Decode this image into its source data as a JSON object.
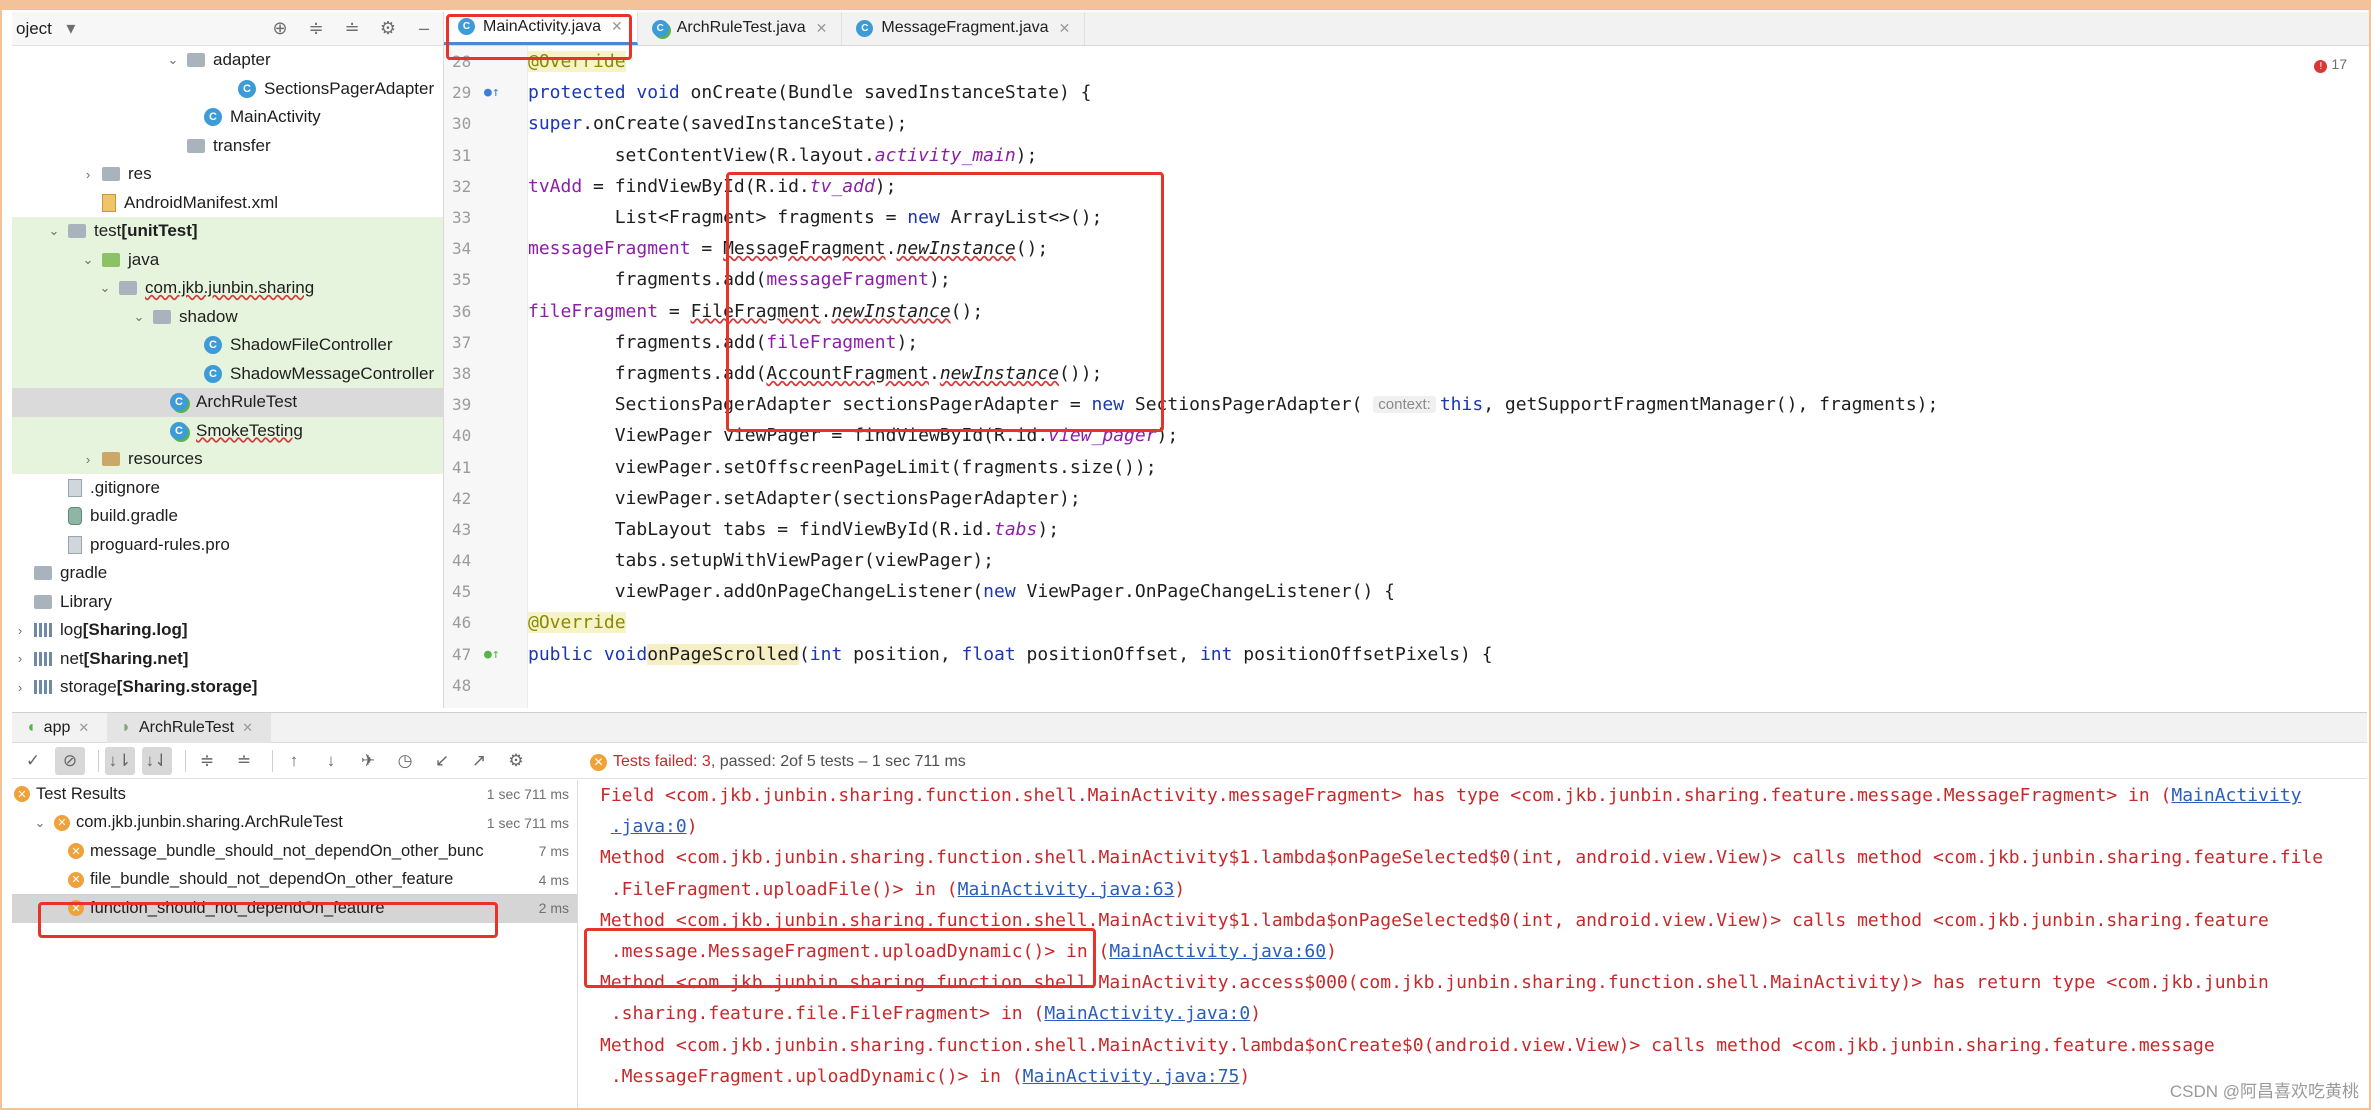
{
  "project_panel": {
    "title": "oject",
    "items": [
      {
        "label": "adapter",
        "type": "folder",
        "indent": 9
      },
      {
        "label": "SectionsPagerAdapter",
        "type": "class",
        "indent": 12
      },
      {
        "label": "MainActivity",
        "type": "class",
        "indent": 10
      },
      {
        "label": "transfer",
        "type": "folder",
        "indent": 9
      },
      {
        "label": "res",
        "type": "folder",
        "indent": 4
      },
      {
        "label": "AndroidManifest.xml",
        "type": "xml",
        "indent": 4
      },
      {
        "label": "test",
        "label_bold": "[unitTest]",
        "type": "folder",
        "indent": 2
      },
      {
        "label": "java",
        "type": "green-folder",
        "indent": 4
      },
      {
        "label": "com.jkb.junbin.sharing",
        "type": "folder",
        "indent": 5
      },
      {
        "label": "shadow",
        "type": "folder",
        "indent": 7
      },
      {
        "label": "ShadowFileController",
        "type": "class",
        "indent": 10
      },
      {
        "label": "ShadowMessageController",
        "type": "class",
        "indent": 10
      },
      {
        "label": "ArchRuleTest",
        "type": "test-class",
        "indent": 8
      },
      {
        "label": "SmokeTesting",
        "type": "test-class",
        "indent": 8
      },
      {
        "label": "resources",
        "type": "folder",
        "indent": 4
      },
      {
        "label": ".gitignore",
        "type": "file",
        "indent": 2
      },
      {
        "label": "build.gradle",
        "type": "gradle",
        "indent": 2
      },
      {
        "label": "proguard-rules.pro",
        "type": "file",
        "indent": 2
      },
      {
        "label": "gradle",
        "type": "folder",
        "indent": 0
      },
      {
        "label": "Library",
        "type": "folder",
        "indent": 0
      },
      {
        "label": "log",
        "label_bold": "[Sharing.log]",
        "type": "lib",
        "indent": 0
      },
      {
        "label": "net",
        "label_bold": "[Sharing.net]",
        "type": "lib",
        "indent": 0
      },
      {
        "label": "storage",
        "label_bold": "[Sharing.storage]",
        "type": "lib",
        "indent": 0
      }
    ]
  },
  "editor": {
    "tabs": [
      {
        "label": "MainActivity.java",
        "active": true
      },
      {
        "label": "ArchRuleTest.java",
        "active": false
      },
      {
        "label": "MessageFragment.java",
        "active": false
      }
    ],
    "error_count": "17",
    "line_numbers": [
      "28",
      "29",
      "30",
      "31",
      "32",
      "33",
      "34",
      "35",
      "36",
      "37",
      "38",
      "39",
      "40",
      "41",
      "42",
      "43",
      "44",
      "45",
      "46",
      "47",
      "48"
    ]
  },
  "run_panel": {
    "tabs": [
      "app",
      "ArchRuleTest"
    ],
    "status": {
      "failed_label": "Tests failed: 3",
      "passed_label": ", passed: 2",
      "total_label": " of 5 tests – 1 sec 711 ms"
    },
    "results": [
      {
        "label": "Test Results",
        "time": "1 sec 711 ms"
      },
      {
        "label": "com.jkb.junbin.sharing.ArchRuleTest",
        "time": "1 sec 711 ms"
      },
      {
        "label": "message_bundle_should_not_dependOn_other_bunc",
        "time": "7 ms"
      },
      {
        "label": "file_bundle_should_not_dependOn_other_feature",
        "time": "4 ms"
      },
      {
        "label": "function_should_not_dependOn_feature",
        "time": "2 ms"
      }
    ],
    "console": [
      {
        "text": "Field <com.jkb.junbin.sharing.function.shell.MainActivity.messageFragment> has type <com.jkb.junbin.sharing.feature.message.MessageFragment> in (",
        "link": "MainActivity",
        "after": ""
      },
      {
        "text": " ",
        "link": ".java:0",
        "after": ")"
      },
      {
        "text": "Method <com.jkb.junbin.sharing.function.shell.MainActivity$1.lambda$onPageSelected$0(int, android.view.View)> calls method <com.jkb.junbin.sharing.feature.file",
        "link": "",
        "after": ""
      },
      {
        "text": " .FileFragment.uploadFile()> in (",
        "link": "MainActivity.java:63",
        "after": ")"
      },
      {
        "text": "Method <com.jkb.junbin.sharing.function.shell.MainActivity$1.lambda$onPageSelected$0(int, android.view.View)> calls method <com.jkb.junbin.sharing.feature",
        "link": "",
        "after": ""
      },
      {
        "text": " .message.MessageFragment.uploadDynamic()> in (",
        "link": "MainActivity.java:60",
        "after": ")"
      },
      {
        "text": "Method <com.jkb.junbin.sharing.function.shell.MainActivity.access$000(com.jkb.junbin.sharing.function.shell.MainActivity)> has return type <com.jkb.junbin",
        "link": "",
        "after": ""
      },
      {
        "text": " .sharing.feature.file.FileFragment> in (",
        "link": "MainActivity.java:0",
        "after": ")"
      },
      {
        "text": "Method <com.jkb.junbin.sharing.function.shell.MainActivity.lambda$onCreate$0(android.view.View)> calls method <com.jkb.junbin.sharing.feature.message",
        "link": "",
        "after": ""
      },
      {
        "text": " .MessageFragment.uploadDynamic()> in (",
        "link": "MainActivity.java:75",
        "after": ")"
      }
    ]
  },
  "watermark": "CSDN @阿昌喜欢吃黄桃",
  "colors": {
    "highlight_box": "#e8322a",
    "test_pass_bg": "#e6f4dd",
    "error_text": "#c7292b",
    "keyword": "#1a35b5",
    "field": "#8c1ea8"
  }
}
